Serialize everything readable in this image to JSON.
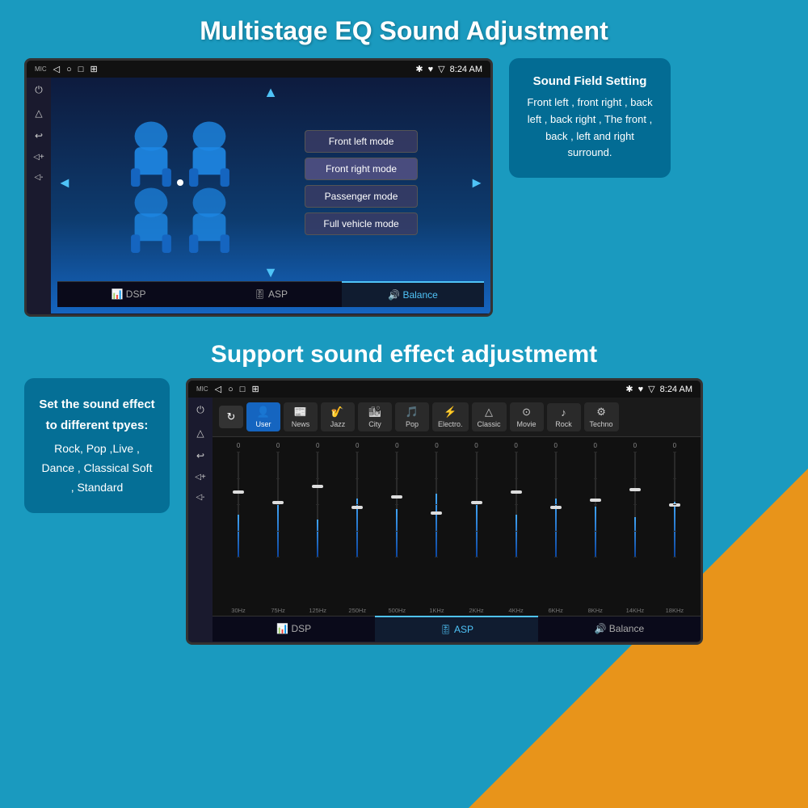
{
  "page": {
    "bg_color": "#1a9abf",
    "section1": {
      "title": "Multistage EQ Sound Adjustment",
      "statusbar": {
        "time": "8:24 AM",
        "icons_left": [
          "◁",
          "○",
          "□",
          "⊞"
        ],
        "icons_right": [
          "✱",
          "♥",
          "▽"
        ]
      },
      "nav_icons": [
        "⏻",
        "△",
        "↩",
        "◁+",
        "◁-"
      ],
      "modes": [
        {
          "label": "Front left mode",
          "active": false
        },
        {
          "label": "Front right mode",
          "active": false
        },
        {
          "label": "Passenger mode",
          "active": false
        },
        {
          "label": "Full vehicle mode",
          "active": false
        }
      ],
      "bottom_tabs": [
        {
          "label": "DSP",
          "icon": "📊",
          "active": false
        },
        {
          "label": "ASP",
          "icon": "🎚",
          "active": false
        },
        {
          "label": "Balance",
          "icon": "🔊",
          "active": true
        }
      ],
      "sound_field": {
        "title": "Sound Field Setting",
        "description": "Front left , front right , back left , back right , The front , back , left and right surround."
      }
    },
    "section2": {
      "title": "Support sound effect adjustmemt",
      "set_sound": {
        "title": "Set the sound effect to different tpyes:",
        "description": "Rock, Pop ,Live , Dance , Classical Soft , Standard"
      },
      "presets": [
        {
          "label": "User",
          "icon": "👤",
          "selected": true
        },
        {
          "label": "News",
          "icon": "📰",
          "selected": false
        },
        {
          "label": "Jazz",
          "icon": "🎷",
          "selected": false
        },
        {
          "label": "City",
          "icon": "🏙",
          "selected": false
        },
        {
          "label": "Pop",
          "icon": "🎵",
          "selected": false
        },
        {
          "label": "Electro.",
          "icon": "⚡",
          "selected": false
        },
        {
          "label": "Classic",
          "icon": "△",
          "selected": false
        },
        {
          "label": "Movie",
          "icon": "⊙",
          "selected": false
        },
        {
          "label": "Rock",
          "icon": "♪",
          "selected": false
        },
        {
          "label": "Techno",
          "icon": "⚙",
          "selected": false
        }
      ],
      "frequencies": [
        "30Hz",
        "75Hz",
        "125Hz",
        "250Hz",
        "500Hz",
        "1KHz",
        "2KHz",
        "4KHz",
        "6KHz",
        "8KHz",
        "14KHz",
        "18KHz"
      ],
      "slider_heights": [
        40,
        50,
        35,
        55,
        45,
        60,
        50,
        40,
        55,
        48,
        38,
        52
      ],
      "slider_positions": [
        60,
        50,
        65,
        45,
        55,
        40,
        50,
        60,
        45,
        52,
        62,
        48
      ],
      "bottom_tabs": [
        {
          "label": "DSP",
          "icon": "📊",
          "active": false
        },
        {
          "label": "ASP",
          "icon": "🎚",
          "active": true
        },
        {
          "label": "Balance",
          "icon": "🔊",
          "active": false
        }
      ]
    }
  }
}
